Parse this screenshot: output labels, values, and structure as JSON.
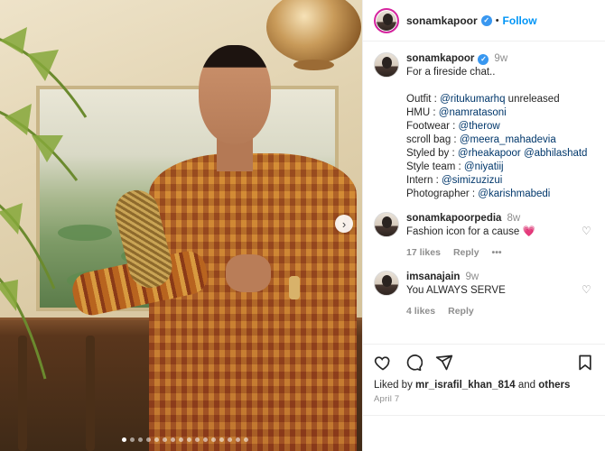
{
  "post": {
    "image_alt": "",
    "carousel_dots": 16,
    "carousel_active": 0
  },
  "header": {
    "username": "sonamkapoor",
    "separator": "•",
    "follow_label": "Follow"
  },
  "caption": {
    "username": "sonamkapoor",
    "time": "9w",
    "lines": [
      {
        "text": "For a fireside chat..",
        "mentions": []
      },
      {
        "text": "",
        "mentions": []
      },
      {
        "text": "Outfit : ",
        "mentions": [
          "@ritukumarhq"
        ],
        "suffix": " unreleased"
      },
      {
        "text": "HMU : ",
        "mentions": [
          "@namratasoni"
        ]
      },
      {
        "text": "Footwear : ",
        "mentions": [
          "@therow"
        ]
      },
      {
        "text": "scroll bag : ",
        "mentions": [
          "@meera_mahadevia"
        ]
      },
      {
        "text": "Styled by : ",
        "mentions": [
          "@rheakapoor",
          "@abhilashatd"
        ]
      },
      {
        "text": "Style team : ",
        "mentions": [
          "@niyatiij"
        ]
      },
      {
        "text": "Intern : ",
        "mentions": [
          "@simizuzizui"
        ]
      },
      {
        "text": "Photographer : ",
        "mentions": [
          "@karishmabedi"
        ]
      }
    ]
  },
  "comments": [
    {
      "username": "sonamkapoorpedia",
      "time": "8w",
      "text": "Fashion icon for a cause",
      "emoji": "💗",
      "likes": "17 likes",
      "reply": "Reply",
      "more": "•••"
    },
    {
      "username": "imsanajain",
      "time": "9w",
      "text": "You ALWAYS SERVE",
      "emoji": "",
      "likes": "4 likes",
      "reply": "Reply",
      "more": ""
    }
  ],
  "footer": {
    "liked_by_prefix": "Liked by ",
    "liked_by_user": "mr_israfil_khan_814",
    "liked_by_and": " and ",
    "liked_by_others": "others",
    "date": "April 7"
  },
  "icons": {
    "verified": "verified-badge-icon",
    "like": "heart-icon",
    "comment": "comment-bubble-icon",
    "share": "paper-plane-icon",
    "save": "bookmark-icon",
    "next": "chevron-right-icon"
  },
  "colors": {
    "link": "#00376b",
    "follow": "#0095f6",
    "muted": "#8e8e8e",
    "verified": "#3897f0"
  }
}
